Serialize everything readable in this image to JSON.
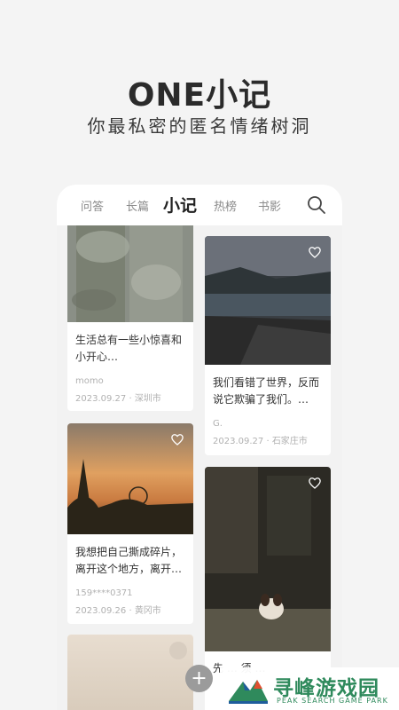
{
  "hero": {
    "title": "ONE小记",
    "subtitle": "你最私密的匿名情绪树洞"
  },
  "tabs": [
    {
      "label": "问答",
      "active": false
    },
    {
      "label": "长篇",
      "active": false
    },
    {
      "label": "小记",
      "active": true
    },
    {
      "label": "热榜",
      "active": false
    },
    {
      "label": "书影",
      "active": false
    }
  ],
  "cards": [
    {
      "text": "生活总有一些小惊喜和小开心…",
      "user": "momo",
      "date": "2023.09.27",
      "city": "深圳市"
    },
    {
      "text": "我们看错了世界，反而说它欺骗了我们。…",
      "user": "G.",
      "date": "2023.09.27",
      "city": "石家庄市"
    },
    {
      "text": "我想把自己撕成碎片，离开这个地方，离开…",
      "user": "159****0371",
      "date": "2023.09.26",
      "city": "黄冈市"
    },
    {
      "text": "先 … 须 …"
    }
  ],
  "add_button": "+",
  "watermark": {
    "title": "寻峰游戏园",
    "subtitle": "PEAK SEARCH GAME PARK"
  },
  "colors": {
    "accent": "#2f8a5c",
    "background": "#f4f4f4"
  }
}
